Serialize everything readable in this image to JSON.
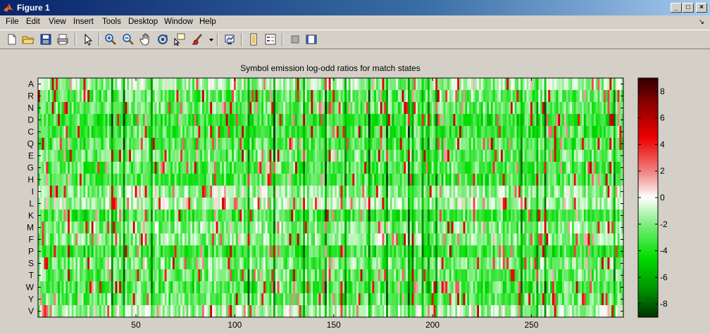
{
  "window": {
    "title": "Figure 1",
    "minimize": "_",
    "maximize": "□",
    "close": "×"
  },
  "menu": {
    "items": [
      "File",
      "Edit",
      "View",
      "Insert",
      "Tools",
      "Desktop",
      "Window",
      "Help"
    ],
    "dock_arrow": "↘"
  },
  "toolbar": {
    "icons": [
      "new-figure-icon",
      "open-file-icon",
      "save-icon",
      "print-icon",
      "edit-plot-icon",
      "zoom-in-icon",
      "zoom-out-icon",
      "pan-icon",
      "rotate-3d-icon",
      "data-cursor-icon",
      "brush-icon",
      "brush-dropdown-icon",
      "link-plot-icon",
      "colorbar-icon",
      "legend-icon",
      "hide-plot-tools-icon",
      "show-plot-tools-icon"
    ]
  },
  "colors": {
    "window_bg": "#d4d0c8",
    "title_start": "#0a246a",
    "title_end": "#a6caf0",
    "colormap_low": "#003300",
    "colormap_mid": "#ffffff",
    "colormap_high": "#330000"
  },
  "chart_data": {
    "type": "heatmap",
    "title": "Symbol emission log-odd ratios for match states",
    "rows": [
      "A",
      "R",
      "N",
      "D",
      "C",
      "Q",
      "E",
      "G",
      "H",
      "I",
      "L",
      "K",
      "M",
      "F",
      "P",
      "S",
      "T",
      "W",
      "Y",
      "V"
    ],
    "x_range": [
      1,
      296
    ],
    "x_ticks": [
      50,
      100,
      150,
      200,
      250
    ],
    "clim": [
      -9,
      9
    ],
    "colorbar_ticks": [
      8,
      6,
      4,
      2,
      0,
      -2,
      -4,
      -6,
      -8
    ],
    "colormap": "green-white-red",
    "note_values": "cell values approximated; mostly negative (green) with scattered positive (red) log-odds"
  }
}
